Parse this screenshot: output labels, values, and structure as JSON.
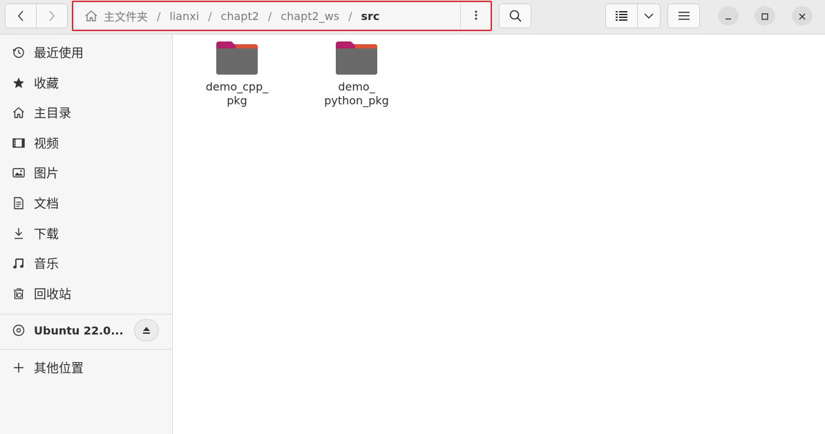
{
  "header": {
    "nav": {
      "back_icon": "chevron-left-icon",
      "forward_icon": "chevron-right-icon"
    },
    "path": {
      "home_icon": "home-icon",
      "crumbs": [
        "主文件夹",
        "lianxi",
        "chapt2",
        "chapt2_ws",
        "src"
      ],
      "separator": "/",
      "menu_icon": "vertical-dots-icon"
    },
    "search_icon": "search-icon",
    "view_list_icon": "list-view-icon",
    "view_dropdown_icon": "chevron-down-icon",
    "menu_icon": "hamburger-icon",
    "window": {
      "minimize_icon": "minimize-icon",
      "maximize_icon": "maximize-icon",
      "close_icon": "close-icon"
    },
    "highlight_color": "#d92b35"
  },
  "sidebar": {
    "places": [
      {
        "label": "最近使用",
        "icon": "recent-icon"
      },
      {
        "label": "收藏",
        "icon": "star-icon"
      },
      {
        "label": "主目录",
        "icon": "home-icon"
      },
      {
        "label": "视频",
        "icon": "video-icon"
      },
      {
        "label": "图片",
        "icon": "picture-icon"
      },
      {
        "label": "文档",
        "icon": "document-icon"
      },
      {
        "label": "下载",
        "icon": "download-icon"
      },
      {
        "label": "音乐",
        "icon": "music-icon"
      },
      {
        "label": "回收站",
        "icon": "trash-icon"
      }
    ],
    "devices": [
      {
        "label": "Ubuntu 22.0...",
        "icon": "disc-icon",
        "action_icon": "eject-icon"
      }
    ],
    "other": {
      "label": "其他位置",
      "icon": "plus-icon"
    }
  },
  "main": {
    "files": [
      {
        "name": "demo_cpp_\npkg",
        "type": "folder",
        "icon": "folder-icon"
      },
      {
        "name": "demo_\npython_pkg",
        "type": "folder",
        "icon": "folder-icon"
      }
    ]
  },
  "colors": {
    "folder_top": "#c2185b",
    "folder_accent": "#e95420",
    "folder_body": "#6b6b6b"
  }
}
